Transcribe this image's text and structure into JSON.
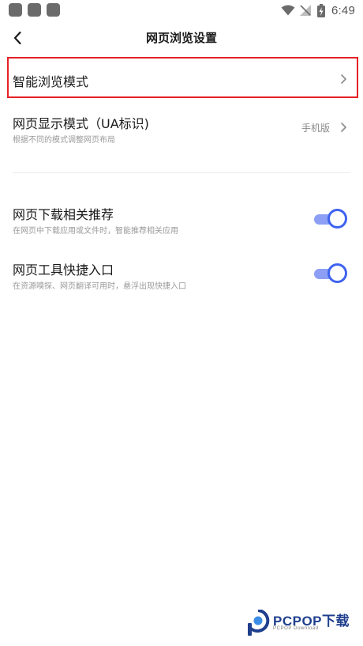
{
  "status_bar": {
    "time": "6:49"
  },
  "header": {
    "title": "网页浏览设置"
  },
  "settings": {
    "smart_browse": {
      "title": "智能浏览模式"
    },
    "display_mode": {
      "title": "网页显示模式（UA标识)",
      "subtitle": "根据不同的模式调整网页布局",
      "value": "手机版"
    },
    "download_recommend": {
      "title": "网页下载相关推荐",
      "subtitle": "在网页中下载应用或文件时，智能推荐相关应用",
      "enabled": true
    },
    "tool_entry": {
      "title": "网页工具快捷入口",
      "subtitle": "在资源嗅探、网页翻译可用时，悬浮出现快捷入口",
      "enabled": true
    }
  },
  "watermark": {
    "brand": "PCPOP下载",
    "sub": "PCPOP Download"
  },
  "colors": {
    "accent": "#3f63f0",
    "toggle_track": "#8c9ff4",
    "highlight": "#e52126"
  }
}
